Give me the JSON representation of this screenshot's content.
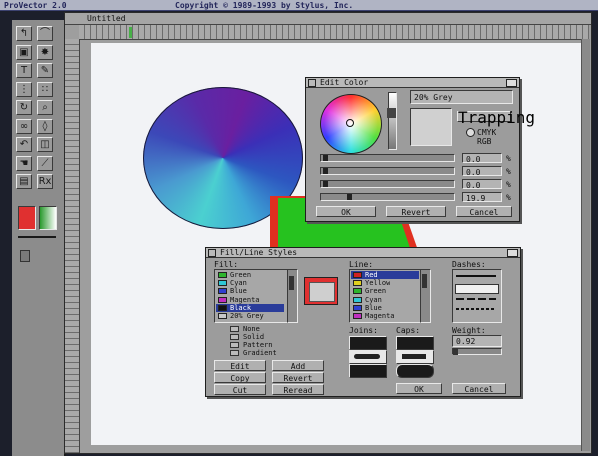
{
  "screen_title": "ProVector 2.0",
  "copyright": "Copyright © 1989-1993 by Stylus, Inc.",
  "doc_window": {
    "title": "Untitled"
  },
  "toolbox": {
    "tools": [
      {
        "name": "point-icon",
        "glyph": "↰"
      },
      {
        "name": "curve-icon",
        "glyph": "⌒"
      },
      {
        "name": "rectangle-icon",
        "glyph": "▣"
      },
      {
        "name": "freehand-icon",
        "glyph": "✸"
      },
      {
        "name": "text-tool-icon",
        "glyph": "T"
      },
      {
        "name": "pen-icon",
        "glyph": "✎"
      },
      {
        "name": "grid-icon",
        "glyph": "⋮"
      },
      {
        "name": "dots-icon",
        "glyph": "∷"
      },
      {
        "name": "rotate-icon",
        "glyph": "↻"
      },
      {
        "name": "zoom-icon",
        "glyph": "⌕"
      },
      {
        "name": "link-icon",
        "glyph": "∞"
      },
      {
        "name": "node-icon",
        "glyph": "◊"
      },
      {
        "name": "undo-icon",
        "glyph": "↶"
      },
      {
        "name": "shape-icon",
        "glyph": "◫"
      },
      {
        "name": "hand-icon",
        "glyph": "☚"
      },
      {
        "name": "knife-icon",
        "glyph": "⟋"
      },
      {
        "name": "paste-icon",
        "glyph": "▤"
      },
      {
        "name": "rx-icon",
        "glyph": "Rx"
      }
    ],
    "fill_color": "#e03030",
    "line_color": "#46b24a"
  },
  "edit_color": {
    "title": "Edit Color",
    "color_name": "20% Grey",
    "trapping_label": "Trapping",
    "modes": [
      "CMYK",
      "RGB"
    ],
    "channels": [
      {
        "value": "0.0",
        "level": 0.0
      },
      {
        "value": "0.0",
        "level": 0.0
      },
      {
        "value": "0.0",
        "level": 0.0
      },
      {
        "value": "19.9",
        "level": 0.2
      }
    ],
    "ok": "OK",
    "revert": "Revert",
    "cancel": "Cancel"
  },
  "fill_line": {
    "title": "Fill/Line Styles",
    "fill_label": "Fill:",
    "fill_colors": [
      {
        "label": "Green",
        "color": "#2db52d"
      },
      {
        "label": "Cyan",
        "color": "#2fc7d6"
      },
      {
        "label": "Blue",
        "color": "#2f3fd0"
      },
      {
        "label": "Magenta",
        "color": "#c02fc0"
      },
      {
        "label": "Black",
        "color": "#111111"
      },
      {
        "label": "20% Grey",
        "color": "#c8c8c8"
      }
    ],
    "line_label": "Line:",
    "line_colors": [
      {
        "label": "Red",
        "color": "#d02020"
      },
      {
        "label": "Yellow",
        "color": "#e0d020"
      },
      {
        "label": "Green",
        "color": "#2db52d"
      },
      {
        "label": "Cyan",
        "color": "#2fc7d6"
      },
      {
        "label": "Blue",
        "color": "#2f3fd0"
      },
      {
        "label": "Magenta",
        "color": "#c02fc0"
      }
    ],
    "dashes_label": "Dashes:",
    "fill_types": [
      "None",
      "Solid",
      "Pattern",
      "Gradient"
    ],
    "joins_label": "Joins:",
    "caps_label": "Caps:",
    "weight_label": "Weight:",
    "weight_value": "0.92",
    "buttons": {
      "edit": "Edit",
      "add": "Add",
      "copy": "Copy",
      "revert": "Revert",
      "cut": "Cut",
      "reread": "Reread",
      "ok": "OK",
      "cancel": "Cancel"
    }
  },
  "colors": {
    "desktop": "#1c1f2b",
    "panel_grey": "#9e9e9e",
    "canvas": "#f2f3f6",
    "selection_blue": "#2a3c9a"
  }
}
